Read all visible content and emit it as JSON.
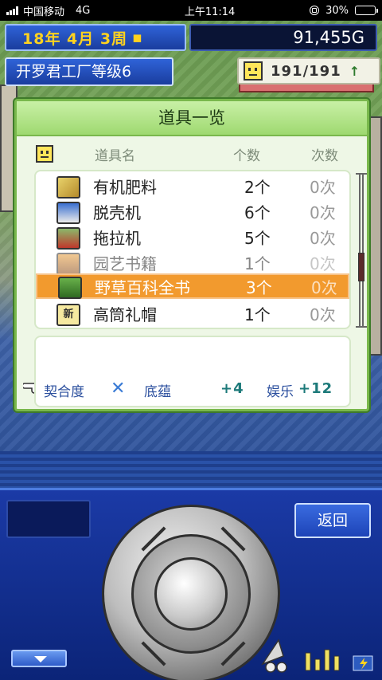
{
  "status_bar": {
    "carrier": "中国移动",
    "network": "4G",
    "time": "上午11:14",
    "battery_percent": "30%",
    "battery_level": 0.3
  },
  "hud": {
    "date": "18年 4月 3周",
    "money": "91,455G",
    "factory_level": "开罗君工厂等级6",
    "happiness": "191/191"
  },
  "panel": {
    "title": "道具一览",
    "columns": {
      "name": "道具名",
      "count": "个数",
      "times": "次数"
    },
    "items": [
      {
        "icon": "fertilizer-icon",
        "name": "有机肥料",
        "count": "2个",
        "times": "0次"
      },
      {
        "icon": "huller-icon",
        "name": "脱壳机",
        "count": "6个",
        "times": "0次"
      },
      {
        "icon": "tractor-icon",
        "name": "拖拉机",
        "count": "5个",
        "times": "0次"
      },
      {
        "icon": "gardening-book-icon",
        "name": "园艺书籍",
        "count": "1个",
        "times": "0次"
      },
      {
        "icon": "encyclopedia-icon",
        "name": "野草百科全书",
        "count": "3个",
        "times": "0次",
        "selected": true
      },
      {
        "icon": "new-badge-icon",
        "name": "高筒礼帽",
        "count": "1个",
        "times": "0次",
        "badge": "新"
      }
    ],
    "stats": {
      "affinity_label": "契合度",
      "depth_label": "底蕴",
      "depth_value": "+4",
      "fun_label": "娱乐",
      "fun_value": "+12"
    }
  },
  "controller": {
    "back_label": "返回"
  },
  "colors": {
    "panel_border": "#79b84c",
    "selection": "#f29a2e",
    "hud_blue": "#1a3d9e",
    "date_yellow": "#ffd21f"
  }
}
